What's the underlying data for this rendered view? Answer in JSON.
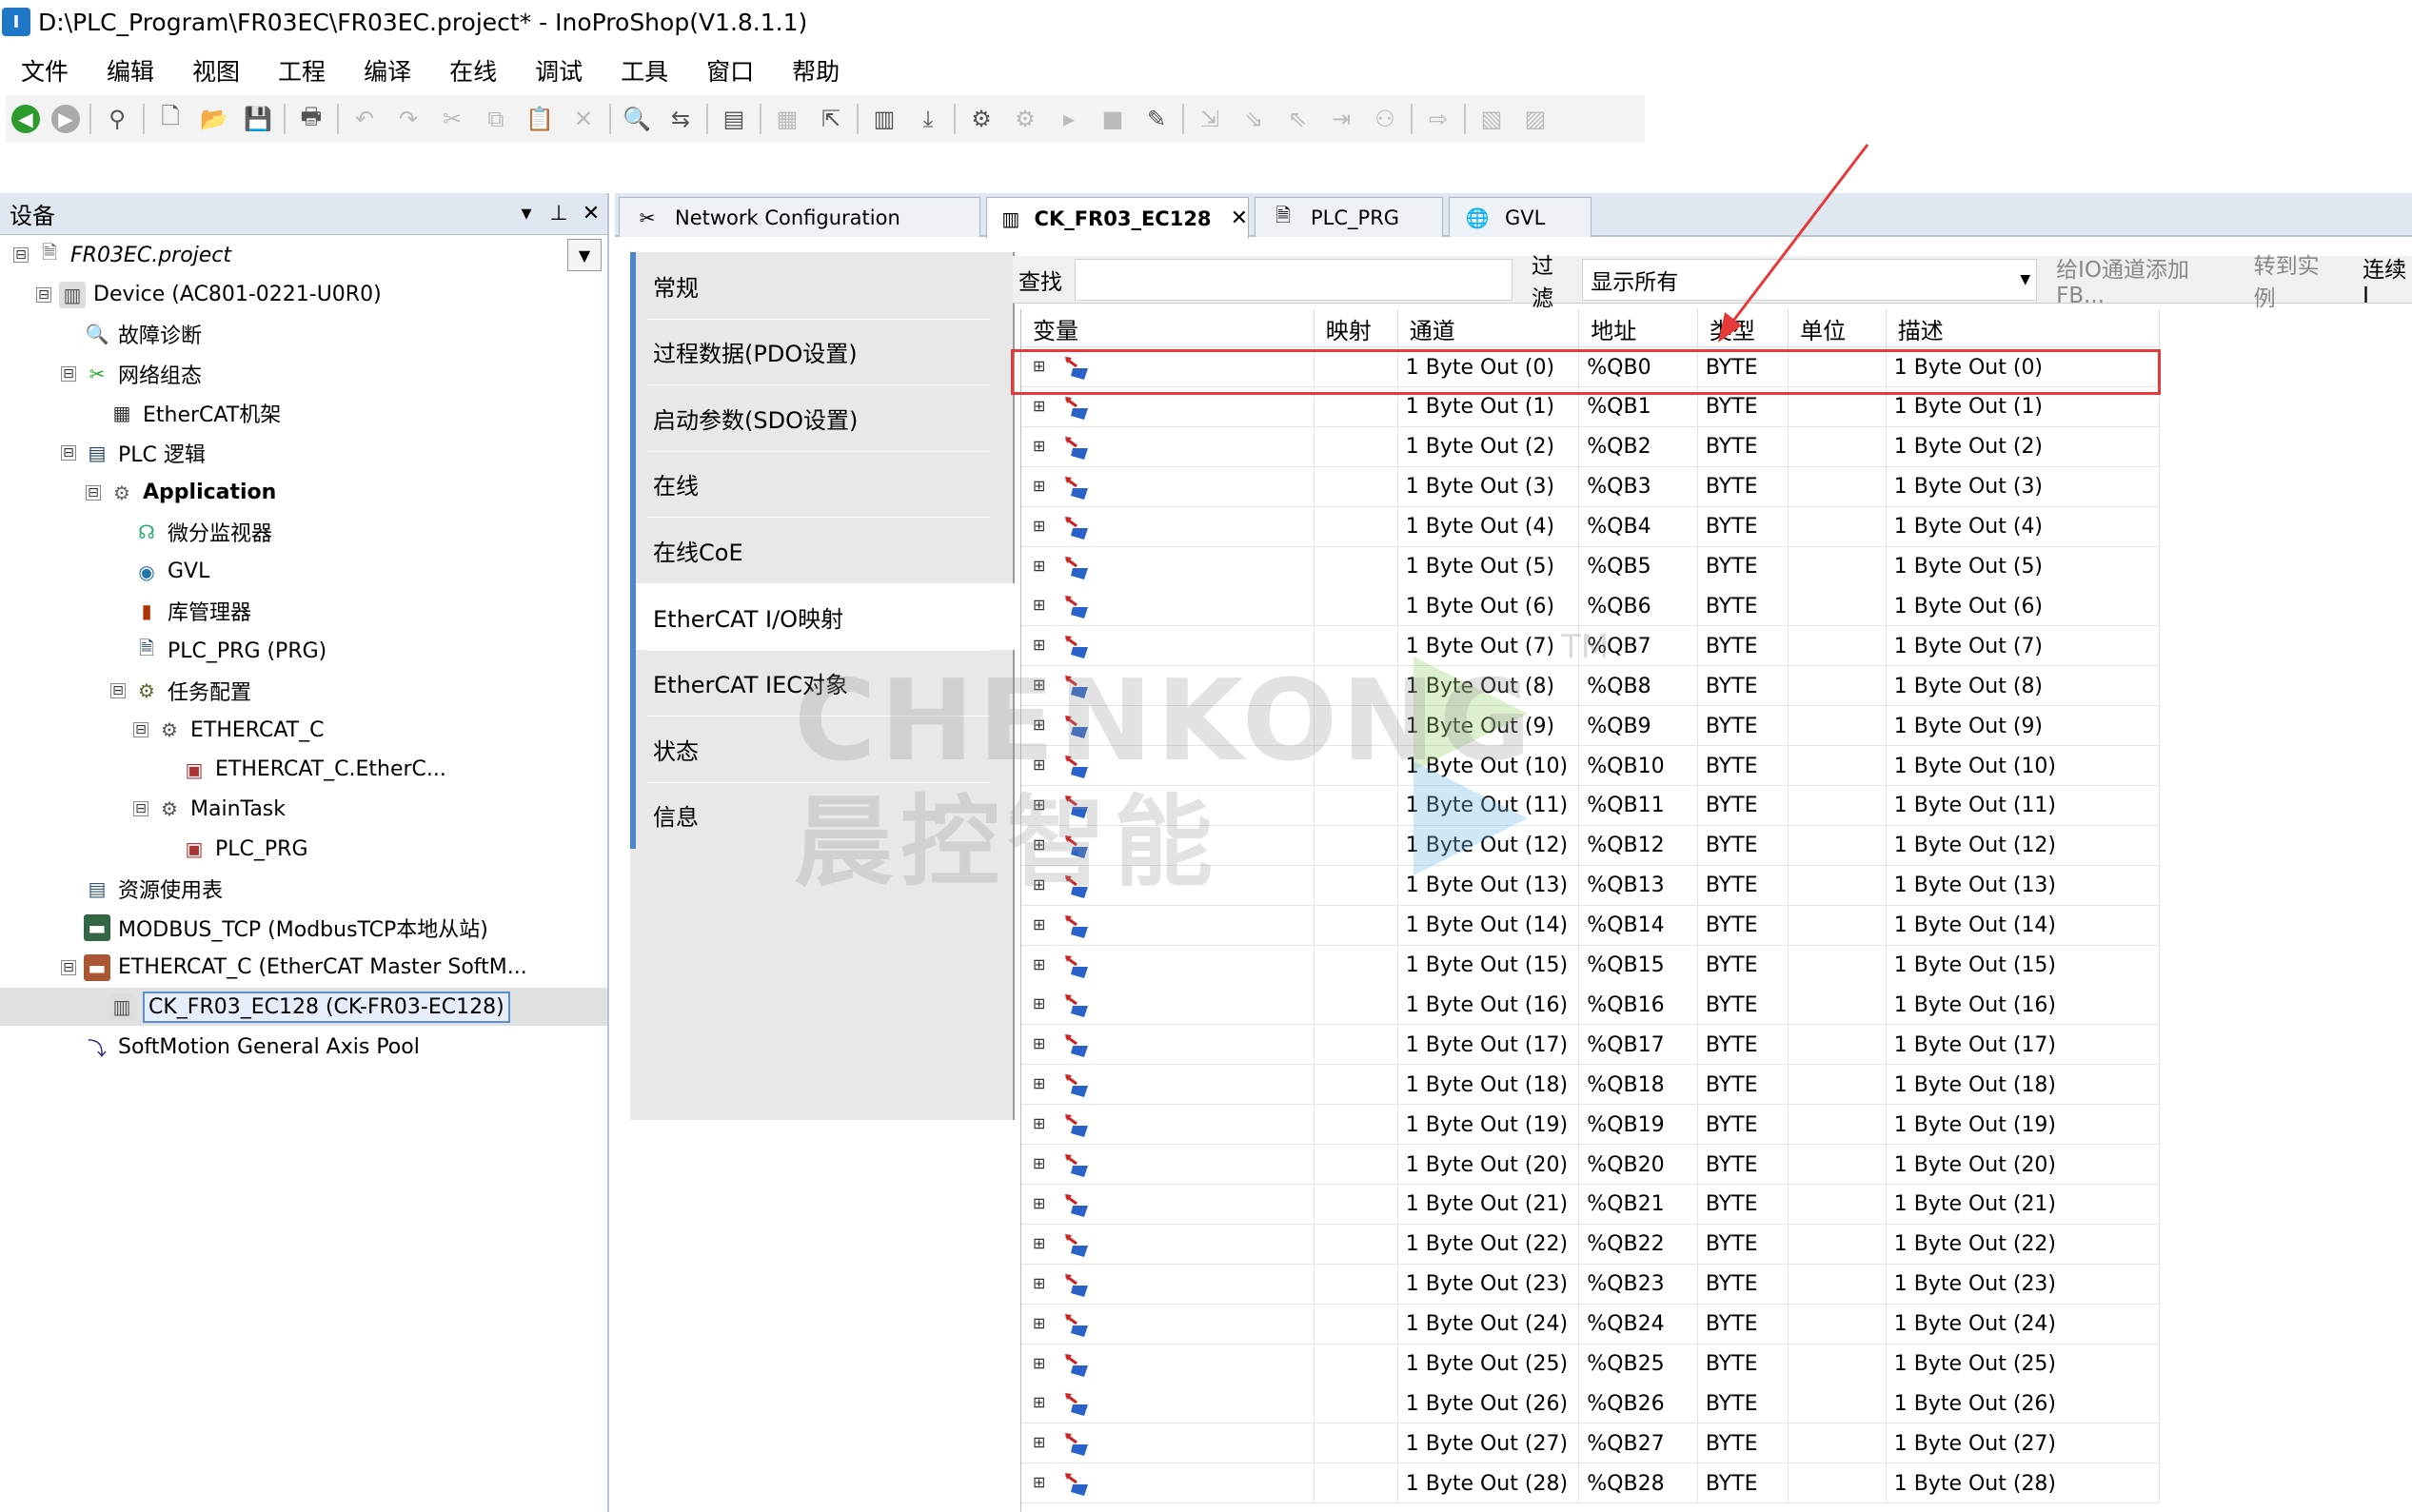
{
  "window": {
    "title": "D:\\PLC_Program\\FR03EC\\FR03EC.project* - InoProShop(V1.8.1.1)"
  },
  "menu": [
    "文件",
    "编辑",
    "视图",
    "工程",
    "编译",
    "在线",
    "调试",
    "工具",
    "窗口",
    "帮助"
  ],
  "devices_panel": {
    "title": "设备",
    "pin": "ᵠ",
    "tree": [
      {
        "label": "FR03EC.project",
        "icon": "project-icon",
        "indent": 0,
        "exp": "⊟",
        "italic": true
      },
      {
        "label": "Device (AC801-0221-U0R0)",
        "icon": "device-icon",
        "indent": 1,
        "exp": "⊟"
      },
      {
        "label": "故障诊断",
        "icon": "diagnosis-icon",
        "indent": 2,
        "exp": ""
      },
      {
        "label": "网络组态",
        "icon": "network-config-icon",
        "indent": 2,
        "exp": "⊟"
      },
      {
        "label": "EtherCAT机架",
        "icon": "ethercat-rack-icon",
        "indent": 3,
        "exp": ""
      },
      {
        "label": "PLC 逻辑",
        "icon": "plc-logic-icon",
        "indent": 2,
        "exp": "⊟"
      },
      {
        "label": "Application",
        "icon": "application-icon",
        "indent": 3,
        "exp": "⊟",
        "bold": true
      },
      {
        "label": "微分监视器",
        "icon": "monitor-icon",
        "indent": 4,
        "exp": ""
      },
      {
        "label": "GVL",
        "icon": "gvl-icon",
        "indent": 4,
        "exp": ""
      },
      {
        "label": "库管理器",
        "icon": "library-icon",
        "indent": 4,
        "exp": ""
      },
      {
        "label": "PLC_PRG (PRG)",
        "icon": "program-icon",
        "indent": 4,
        "exp": ""
      },
      {
        "label": "任务配置",
        "icon": "task-config-icon",
        "indent": 4,
        "exp": "⊟"
      },
      {
        "label": "ETHERCAT_C",
        "icon": "task-icon",
        "indent": 5,
        "exp": "⊟"
      },
      {
        "label": "ETHERCAT_C.EtherC...",
        "icon": "task-call-icon",
        "indent": 6,
        "exp": ""
      },
      {
        "label": "MainTask",
        "icon": "task-icon",
        "indent": 5,
        "exp": "⊟"
      },
      {
        "label": "PLC_PRG",
        "icon": "task-call-icon",
        "indent": 6,
        "exp": ""
      },
      {
        "label": "资源使用表",
        "icon": "resource-table-icon",
        "indent": 2,
        "exp": ""
      },
      {
        "label": "MODBUS_TCP (ModbusTCP本地从站)",
        "icon": "modbus-icon",
        "indent": 2,
        "exp": ""
      },
      {
        "label": "ETHERCAT_C (EtherCAT Master SoftM...",
        "icon": "ethercat-master-icon",
        "indent": 2,
        "exp": "⊟"
      },
      {
        "label": "CK_FR03_EC128 (CK-FR03-EC128)",
        "icon": "slave-device-icon",
        "indent": 3,
        "exp": "",
        "selected": true
      },
      {
        "label": "SoftMotion General Axis Pool",
        "icon": "axis-pool-icon",
        "indent": 2,
        "exp": ""
      }
    ]
  },
  "tabs": [
    {
      "label": "Network Configuration",
      "icon": "network-config-icon",
      "active": false
    },
    {
      "label": "CK_FR03_EC128",
      "icon": "slave-device-icon",
      "active": true,
      "close": "✕"
    },
    {
      "label": "PLC_PRG",
      "icon": "program-icon",
      "active": false
    },
    {
      "label": "GVL",
      "icon": "gvl-icon",
      "active": false
    }
  ],
  "side_tabs": [
    "常规",
    "过程数据(PDO设置)",
    "启动参数(SDO设置)",
    "在线",
    "在线CoE",
    "EtherCAT I/O映射",
    "EtherCAT IEC对象",
    "状态",
    "信息"
  ],
  "active_side_tab": 5,
  "find_bar": {
    "find_label": "查找",
    "filter_label": "过滤",
    "filter_value": "显示所有",
    "add_fb": "给IO通道添加FB...",
    "goto_instance": "转到实例",
    "always_update": "连续I"
  },
  "grid": {
    "columns": [
      "变量",
      "映射",
      "通道",
      "地址",
      "类型",
      "单位",
      "描述"
    ],
    "rows": [
      {
        "channel": "1 Byte Out (0)",
        "address": "%QB0",
        "type": "BYTE",
        "desc": "1 Byte Out (0)"
      },
      {
        "channel": "1 Byte Out (1)",
        "address": "%QB1",
        "type": "BYTE",
        "desc": "1 Byte Out (1)"
      },
      {
        "channel": "1 Byte Out (2)",
        "address": "%QB2",
        "type": "BYTE",
        "desc": "1 Byte Out (2)"
      },
      {
        "channel": "1 Byte Out (3)",
        "address": "%QB3",
        "type": "BYTE",
        "desc": "1 Byte Out (3)"
      },
      {
        "channel": "1 Byte Out (4)",
        "address": "%QB4",
        "type": "BYTE",
        "desc": "1 Byte Out (4)"
      },
      {
        "channel": "1 Byte Out (5)",
        "address": "%QB5",
        "type": "BYTE",
        "desc": "1 Byte Out (5)"
      },
      {
        "channel": "1 Byte Out (6)",
        "address": "%QB6",
        "type": "BYTE",
        "desc": "1 Byte Out (6)"
      },
      {
        "channel": "1 Byte Out (7)",
        "address": "%QB7",
        "type": "BYTE",
        "desc": "1 Byte Out (7)"
      },
      {
        "channel": "1 Byte Out (8)",
        "address": "%QB8",
        "type": "BYTE",
        "desc": "1 Byte Out (8)"
      },
      {
        "channel": "1 Byte Out (9)",
        "address": "%QB9",
        "type": "BYTE",
        "desc": "1 Byte Out (9)"
      },
      {
        "channel": "1 Byte Out (10)",
        "address": "%QB10",
        "type": "BYTE",
        "desc": "1 Byte Out (10)"
      },
      {
        "channel": "1 Byte Out (11)",
        "address": "%QB11",
        "type": "BYTE",
        "desc": "1 Byte Out (11)"
      },
      {
        "channel": "1 Byte Out (12)",
        "address": "%QB12",
        "type": "BYTE",
        "desc": "1 Byte Out (12)"
      },
      {
        "channel": "1 Byte Out (13)",
        "address": "%QB13",
        "type": "BYTE",
        "desc": "1 Byte Out (13)"
      },
      {
        "channel": "1 Byte Out (14)",
        "address": "%QB14",
        "type": "BYTE",
        "desc": "1 Byte Out (14)"
      },
      {
        "channel": "1 Byte Out (15)",
        "address": "%QB15",
        "type": "BYTE",
        "desc": "1 Byte Out (15)"
      },
      {
        "channel": "1 Byte Out (16)",
        "address": "%QB16",
        "type": "BYTE",
        "desc": "1 Byte Out (16)"
      },
      {
        "channel": "1 Byte Out (17)",
        "address": "%QB17",
        "type": "BYTE",
        "desc": "1 Byte Out (17)"
      },
      {
        "channel": "1 Byte Out (18)",
        "address": "%QB18",
        "type": "BYTE",
        "desc": "1 Byte Out (18)"
      },
      {
        "channel": "1 Byte Out (19)",
        "address": "%QB19",
        "type": "BYTE",
        "desc": "1 Byte Out (19)"
      },
      {
        "channel": "1 Byte Out (20)",
        "address": "%QB20",
        "type": "BYTE",
        "desc": "1 Byte Out (20)"
      },
      {
        "channel": "1 Byte Out (21)",
        "address": "%QB21",
        "type": "BYTE",
        "desc": "1 Byte Out (21)"
      },
      {
        "channel": "1 Byte Out (22)",
        "address": "%QB22",
        "type": "BYTE",
        "desc": "1 Byte Out (22)"
      },
      {
        "channel": "1 Byte Out (23)",
        "address": "%QB23",
        "type": "BYTE",
        "desc": "1 Byte Out (23)"
      },
      {
        "channel": "1 Byte Out (24)",
        "address": "%QB24",
        "type": "BYTE",
        "desc": "1 Byte Out (24)"
      },
      {
        "channel": "1 Byte Out (25)",
        "address": "%QB25",
        "type": "BYTE",
        "desc": "1 Byte Out (25)"
      },
      {
        "channel": "1 Byte Out (26)",
        "address": "%QB26",
        "type": "BYTE",
        "desc": "1 Byte Out (26)"
      },
      {
        "channel": "1 Byte Out (27)",
        "address": "%QB27",
        "type": "BYTE",
        "desc": "1 Byte Out (27)"
      },
      {
        "channel": "1 Byte Out (28)",
        "address": "%QB28",
        "type": "BYTE",
        "desc": "1 Byte Out (28)"
      }
    ]
  },
  "watermark": {
    "line1": "CHENKONG",
    "line2": "晨控智能",
    "tm": "TM"
  },
  "colors": {
    "highlight": "#e63a3a",
    "accent": "#4a86c8"
  }
}
